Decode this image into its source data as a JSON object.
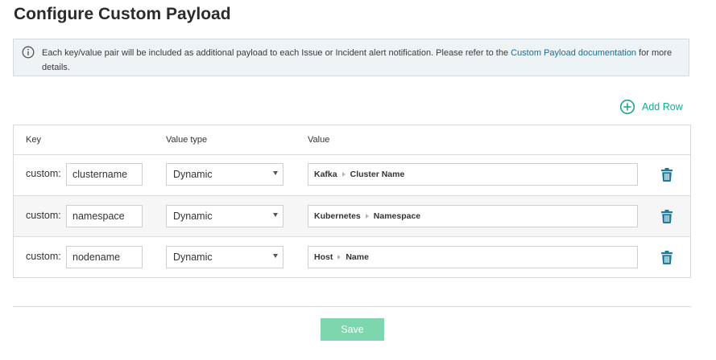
{
  "page": {
    "title": "Configure Custom Payload"
  },
  "info": {
    "icon": "info-circle-icon",
    "text_before": "Each key/value pair will be included as additional payload to each Issue or Incident alert notification. Please refer to the ",
    "link_text": "Custom Payload documentation",
    "text_after": " for more details."
  },
  "actions": {
    "add_row_label": "Add Row",
    "add_row_icon": "plus-circle-icon"
  },
  "table": {
    "headers": {
      "key": "Key",
      "value_type": "Value type",
      "value": "Value"
    },
    "rows": [
      {
        "prefix": "custom:",
        "key": "clustername",
        "value_type": "Dynamic",
        "value_path": [
          "Kafka",
          "Cluster Name"
        ]
      },
      {
        "prefix": "custom:",
        "key": "namespace",
        "value_type": "Dynamic",
        "value_path": [
          "Kubernetes",
          "Namespace"
        ]
      },
      {
        "prefix": "custom:",
        "key": "nodename",
        "value_type": "Dynamic",
        "value_path": [
          "Host",
          "Name"
        ]
      }
    ]
  },
  "footer": {
    "save_label": "Save"
  },
  "colors": {
    "accent": "#1aa88e",
    "link": "#1a6e8f",
    "trash": "#1f7a9e",
    "save_bg": "#7dd6ad",
    "info_bg": "#eef3f6"
  }
}
